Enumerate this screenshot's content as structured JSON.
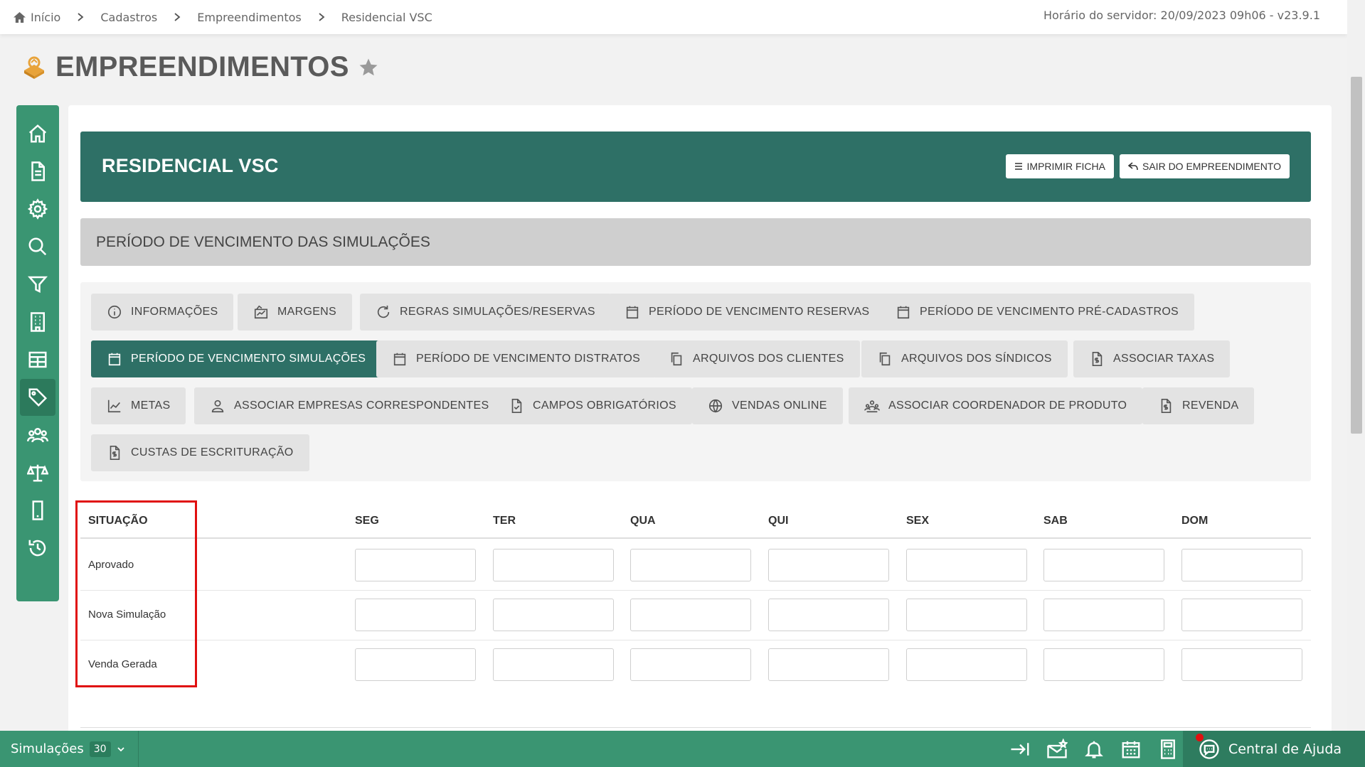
{
  "breadcrumb": {
    "items": [
      "Início",
      "Cadastros",
      "Empreendimentos",
      "Residencial VSC"
    ]
  },
  "server_time": "Horário do servidor: 20/09/2023 09h06 - v23.9.1",
  "page": {
    "title": "EMPREENDIMENTOS"
  },
  "sidenav": {
    "items": [
      "home-icon",
      "document-icon",
      "settings-icon",
      "search-icon",
      "filter-icon",
      "building-icon",
      "table-icon",
      "tag-icon",
      "users-icon",
      "scale-icon",
      "mobile-icon",
      "history-icon"
    ],
    "active": "tag-icon"
  },
  "banner": {
    "title": "RESIDENCIAL VSC",
    "print_label": "IMPRIMIR FICHA",
    "exit_label": "SAIR DO EMPREENDIMENTO"
  },
  "section": {
    "title": "PERÍODO DE VENCIMENTO DAS SIMULAÇÕES"
  },
  "tabs": [
    {
      "label": "INFORMAÇÕES",
      "icon": "info-icon"
    },
    {
      "label": "MARGENS",
      "icon": "chart-box-icon"
    },
    {
      "label": "REGRAS SIMULAÇÕES/RESERVAS",
      "icon": "refresh-icon"
    },
    {
      "label": "PERÍODO DE VENCIMENTO RESERVAS",
      "icon": "calendar-icon"
    },
    {
      "label": "PERÍODO DE VENCIMENTO PRÉ-CADASTROS",
      "icon": "calendar-icon"
    },
    {
      "label": "PERÍODO DE VENCIMENTO SIMULAÇÕES",
      "icon": "calendar-icon",
      "active": true
    },
    {
      "label": "PERÍODO DE VENCIMENTO DISTRATOS",
      "icon": "calendar-icon"
    },
    {
      "label": "ARQUIVOS DOS CLIENTES",
      "icon": "copy-icon"
    },
    {
      "label": "ARQUIVOS DOS SÍNDICOS",
      "icon": "copy-icon"
    },
    {
      "label": "ASSOCIAR TAXAS",
      "icon": "dollar-file-icon"
    },
    {
      "label": "METAS",
      "icon": "line-chart-icon"
    },
    {
      "label": "ASSOCIAR EMPRESAS CORRESPONDENTES",
      "icon": "user-icon"
    },
    {
      "label": "CAMPOS OBRIGATÓRIOS",
      "icon": "check-file-icon"
    },
    {
      "label": "VENDAS ONLINE",
      "icon": "globe-icon"
    },
    {
      "label": "ASSOCIAR COORDENADOR DE PRODUTO",
      "icon": "team-icon"
    },
    {
      "label": "REVENDA",
      "icon": "dollar-file-icon"
    },
    {
      "label": "CUSTAS DE ESCRITURAÇÃO",
      "icon": "dollar-file-icon"
    }
  ],
  "table": {
    "headers": [
      "SITUAÇÃO",
      "SEG",
      "TER",
      "QUA",
      "QUI",
      "SEX",
      "SAB",
      "DOM"
    ],
    "rows": [
      {
        "situacao": "Aprovado",
        "values": [
          "",
          "",
          "",
          "",
          "",
          "",
          ""
        ]
      },
      {
        "situacao": "Nova Simulação",
        "values": [
          "",
          "",
          "",
          "",
          "",
          "",
          ""
        ]
      },
      {
        "situacao": "Venda Gerada",
        "values": [
          "",
          "",
          "",
          "",
          "",
          "",
          ""
        ]
      }
    ]
  },
  "footer": {
    "simulations_label": "Simulações",
    "simulations_count": "30",
    "icons": [
      "collapse-right-icon",
      "mail-icon",
      "bell-icon",
      "calendar-icon",
      "calculator-icon"
    ],
    "help_label": "Central de Ajuda"
  },
  "colors": {
    "primary_green": "#3a9572",
    "dark_teal": "#2e7066",
    "highlight_red": "#e01010"
  }
}
